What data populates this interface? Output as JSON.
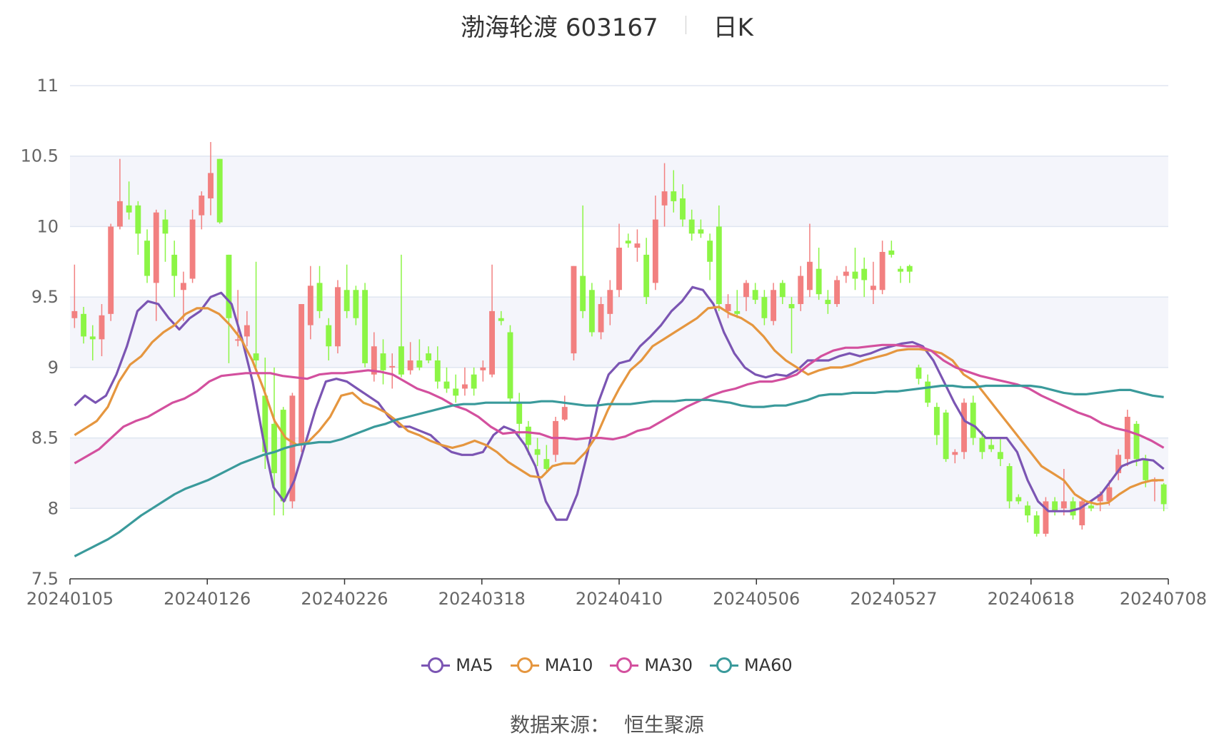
{
  "title": {
    "name": "渤海轮渡 603167",
    "period": "日K"
  },
  "source": {
    "label": "数据来源：",
    "value": "恒生聚源"
  },
  "chart_data": {
    "type": "candlestick",
    "ylim": [
      7.5,
      11
    ],
    "y_ticks": [
      "7.5",
      "8",
      "8.5",
      "9",
      "9.5",
      "10",
      "10.5",
      "11"
    ],
    "x_ticks": [
      "20240105",
      "20240126",
      "20240226",
      "20240318",
      "20240410",
      "20240506",
      "20240527",
      "20240618",
      "20240708"
    ],
    "colors": {
      "up": "#f28080",
      "down": "#8cf545",
      "band": "#f4f5fb",
      "grid": "#e0e6f1",
      "axis": "#333333"
    },
    "candles": [
      [
        9.35,
        9.4,
        9.73,
        9.28
      ],
      [
        9.38,
        9.22,
        9.43,
        9.17
      ],
      [
        9.22,
        9.2,
        9.3,
        9.05
      ],
      [
        9.2,
        9.37,
        9.45,
        9.08
      ],
      [
        9.38,
        10.0,
        10.02,
        9.33
      ],
      [
        10.0,
        10.18,
        10.48,
        9.98
      ],
      [
        10.15,
        10.1,
        10.32,
        10.05
      ],
      [
        10.15,
        9.95,
        10.18,
        9.8
      ],
      [
        9.9,
        9.65,
        9.98,
        9.6
      ],
      [
        9.6,
        10.1,
        10.12,
        9.33
      ],
      [
        10.05,
        9.95,
        10.12,
        9.75
      ],
      [
        9.8,
        9.65,
        9.9,
        9.5
      ],
      [
        9.55,
        9.6,
        9.68,
        9.33
      ],
      [
        9.63,
        10.05,
        10.12,
        9.6
      ],
      [
        10.08,
        10.22,
        10.25,
        9.98
      ],
      [
        10.2,
        10.38,
        10.6,
        10.08
      ],
      [
        10.48,
        10.03,
        10.48,
        10.02
      ],
      [
        9.8,
        9.35,
        9.8,
        9.03
      ],
      [
        9.2,
        9.2,
        9.55,
        9.15
      ],
      [
        9.22,
        9.3,
        9.4,
        9.15
      ],
      [
        9.1,
        9.05,
        9.75,
        8.98
      ],
      [
        8.8,
        8.4,
        9.07,
        8.28
      ],
      [
        8.6,
        8.25,
        9.0,
        7.95
      ],
      [
        8.7,
        8.05,
        8.72,
        7.95
      ],
      [
        8.05,
        8.8,
        8.82,
        8.0
      ],
      [
        8.45,
        9.45,
        9.45,
        8.4
      ],
      [
        9.3,
        9.58,
        9.72,
        9.2
      ],
      [
        9.6,
        9.4,
        9.72,
        9.35
      ],
      [
        9.3,
        9.15,
        9.35,
        9.05
      ],
      [
        9.15,
        9.57,
        9.62,
        9.1
      ],
      [
        9.55,
        9.4,
        9.73,
        9.35
      ],
      [
        9.55,
        9.35,
        9.58,
        9.3
      ],
      [
        9.55,
        9.03,
        9.6,
        9.0
      ],
      [
        8.95,
        9.15,
        9.25,
        8.9
      ],
      [
        9.1,
        8.98,
        9.2,
        8.88
      ],
      [
        9.0,
        9.01,
        9.1,
        8.85
      ],
      [
        9.15,
        8.95,
        9.8,
        8.93
      ],
      [
        8.98,
        9.05,
        9.18,
        8.95
      ],
      [
        9.05,
        9.0,
        9.2,
        8.98
      ],
      [
        9.1,
        9.05,
        9.15,
        9.03
      ],
      [
        9.05,
        8.9,
        9.15,
        8.85
      ],
      [
        8.9,
        8.85,
        9.0,
        8.82
      ],
      [
        8.85,
        8.8,
        8.95,
        8.75
      ],
      [
        8.85,
        8.88,
        9.0,
        8.8
      ],
      [
        8.95,
        8.85,
        9.0,
        8.8
      ],
      [
        8.98,
        9.0,
        9.05,
        8.9
      ],
      [
        8.95,
        9.4,
        9.73,
        8.93
      ],
      [
        9.35,
        9.33,
        9.4,
        9.3
      ],
      [
        9.25,
        8.78,
        9.3,
        8.75
      ],
      [
        8.75,
        8.6,
        8.82,
        8.5
      ],
      [
        8.58,
        8.45,
        8.62,
        8.38
      ],
      [
        8.42,
        8.38,
        8.5,
        8.3
      ],
      [
        8.35,
        8.28,
        8.45,
        8.25
      ],
      [
        8.38,
        8.62,
        8.65,
        8.33
      ],
      [
        8.63,
        8.72,
        8.8,
        8.62
      ],
      [
        9.1,
        9.72,
        9.72,
        9.05
      ],
      [
        9.65,
        9.4,
        10.15,
        9.35
      ],
      [
        9.55,
        9.25,
        9.6,
        9.22
      ],
      [
        9.25,
        9.45,
        9.5,
        9.2
      ],
      [
        9.38,
        9.55,
        9.62,
        9.3
      ],
      [
        9.55,
        9.85,
        10.02,
        9.5
      ],
      [
        9.9,
        9.88,
        9.95,
        9.85
      ],
      [
        9.85,
        9.88,
        9.98,
        9.75
      ],
      [
        9.8,
        9.5,
        9.92,
        9.45
      ],
      [
        9.6,
        10.05,
        10.22,
        9.55
      ],
      [
        10.15,
        10.25,
        10.45,
        10.0
      ],
      [
        10.25,
        10.18,
        10.4,
        10.1
      ],
      [
        10.2,
        10.05,
        10.3,
        10.0
      ],
      [
        10.05,
        9.95,
        10.12,
        9.9
      ],
      [
        9.98,
        9.95,
        10.05,
        9.92
      ],
      [
        9.9,
        9.75,
        9.95,
        9.62
      ],
      [
        10.0,
        9.45,
        10.15,
        9.4
      ],
      [
        9.4,
        9.45,
        9.52,
        9.35
      ],
      [
        9.4,
        9.38,
        9.55,
        9.35
      ],
      [
        9.5,
        9.6,
        9.62,
        9.4
      ],
      [
        9.55,
        9.48,
        9.6,
        9.45
      ],
      [
        9.5,
        9.35,
        9.55,
        9.3
      ],
      [
        9.33,
        9.55,
        9.6,
        9.3
      ],
      [
        9.6,
        9.5,
        9.62,
        9.45
      ],
      [
        9.45,
        9.42,
        9.5,
        9.1
      ],
      [
        9.45,
        9.65,
        9.72,
        9.4
      ],
      [
        9.55,
        9.75,
        10.02,
        9.5
      ],
      [
        9.7,
        9.52,
        9.85,
        9.48
      ],
      [
        9.48,
        9.45,
        9.55,
        9.38
      ],
      [
        9.45,
        9.62,
        9.65,
        9.43
      ],
      [
        9.65,
        9.68,
        9.72,
        9.6
      ],
      [
        9.68,
        9.63,
        9.85,
        9.55
      ],
      [
        9.7,
        9.62,
        9.78,
        9.5
      ],
      [
        9.55,
        9.58,
        9.75,
        9.45
      ],
      [
        9.55,
        9.82,
        9.9,
        9.52
      ],
      [
        9.83,
        9.8,
        9.9,
        9.78
      ],
      [
        9.7,
        9.68,
        9.72,
        9.6
      ],
      [
        9.72,
        9.68,
        9.73,
        9.6
      ],
      [
        9.0,
        8.92,
        9.02,
        8.88
      ],
      [
        8.9,
        8.75,
        8.95,
        8.72
      ],
      [
        8.72,
        8.52,
        8.75,
        8.45
      ],
      [
        8.68,
        8.35,
        8.7,
        8.33
      ],
      [
        8.38,
        8.4,
        8.42,
        8.32
      ],
      [
        8.4,
        8.75,
        8.78,
        8.35
      ],
      [
        8.75,
        8.5,
        8.8,
        8.45
      ],
      [
        8.5,
        8.4,
        8.55,
        8.35
      ],
      [
        8.45,
        8.42,
        8.5,
        8.4
      ],
      [
        8.4,
        8.35,
        8.5,
        8.3
      ],
      [
        8.3,
        8.05,
        8.32,
        8.0
      ],
      [
        8.08,
        8.05,
        8.1,
        8.03
      ],
      [
        8.02,
        7.95,
        8.05,
        7.9
      ],
      [
        7.95,
        7.82,
        7.98,
        7.8
      ],
      [
        7.82,
        8.05,
        8.08,
        7.8
      ],
      [
        8.05,
        7.98,
        8.08,
        7.95
      ],
      [
        8.0,
        8.05,
        8.28,
        7.95
      ],
      [
        8.05,
        7.95,
        8.08,
        7.92
      ],
      [
        7.88,
        8.05,
        8.07,
        7.85
      ],
      [
        8.02,
        8.0,
        8.06,
        7.98
      ],
      [
        8.05,
        8.1,
        8.12,
        7.98
      ],
      [
        8.05,
        8.15,
        8.2,
        8.02
      ],
      [
        8.25,
        8.38,
        8.42,
        8.2
      ],
      [
        8.35,
        8.65,
        8.7,
        8.3
      ],
      [
        8.6,
        8.35,
        8.62,
        8.3
      ],
      [
        8.35,
        8.2,
        8.38,
        8.15
      ],
      [
        8.2,
        8.2,
        8.22,
        8.05
      ],
      [
        8.17,
        8.03,
        8.18,
        7.98
      ]
    ],
    "series": [
      {
        "name": "MA5",
        "color": "#7b55b3",
        "values": [
          8.73,
          8.8,
          8.75,
          8.8,
          8.95,
          9.15,
          9.4,
          9.47,
          9.45,
          9.35,
          9.27,
          9.35,
          9.4,
          9.5,
          9.53,
          9.45,
          9.2,
          8.9,
          8.5,
          8.15,
          8.05,
          8.2,
          8.45,
          8.7,
          8.9,
          8.92,
          8.9,
          8.85,
          8.8,
          8.75,
          8.65,
          8.58,
          8.58,
          8.55,
          8.52,
          8.45,
          8.4,
          8.38,
          8.38,
          8.4,
          8.52,
          8.58,
          8.55,
          8.45,
          8.3,
          8.05,
          7.92,
          7.92,
          8.1,
          8.4,
          8.75,
          8.95,
          9.03,
          9.05,
          9.15,
          9.22,
          9.3,
          9.4,
          9.47,
          9.57,
          9.55,
          9.45,
          9.25,
          9.1,
          9.0,
          8.95,
          8.93,
          8.95,
          8.94,
          8.98,
          9.05,
          9.05,
          9.05,
          9.08,
          9.1,
          9.08,
          9.1,
          9.13,
          9.15,
          9.17,
          9.18,
          9.15,
          9.05,
          8.9,
          8.75,
          8.62,
          8.58,
          8.5,
          8.5,
          8.5,
          8.4,
          8.2,
          8.05,
          7.98,
          7.98,
          7.98,
          8.0,
          8.05,
          8.1,
          8.2,
          8.3,
          8.33,
          8.35,
          8.34,
          8.28
        ]
      },
      {
        "name": "MA10",
        "color": "#e5963f",
        "values": [
          8.52,
          8.57,
          8.62,
          8.72,
          8.9,
          9.02,
          9.08,
          9.18,
          9.25,
          9.3,
          9.38,
          9.42,
          9.42,
          9.38,
          9.3,
          9.2,
          9.05,
          8.85,
          8.62,
          8.5,
          8.45,
          8.47,
          8.55,
          8.65,
          8.8,
          8.82,
          8.75,
          8.72,
          8.68,
          8.62,
          8.55,
          8.52,
          8.48,
          8.45,
          8.43,
          8.45,
          8.48,
          8.45,
          8.4,
          8.33,
          8.28,
          8.23,
          8.22,
          8.3,
          8.32,
          8.32,
          8.4,
          8.52,
          8.7,
          8.85,
          8.98,
          9.05,
          9.15,
          9.2,
          9.25,
          9.3,
          9.35,
          9.42,
          9.43,
          9.38,
          9.35,
          9.3,
          9.22,
          9.12,
          9.05,
          9.0,
          8.95,
          8.98,
          9.0,
          9.0,
          9.02,
          9.05,
          9.07,
          9.09,
          9.12,
          9.13,
          9.13,
          9.12,
          9.1,
          9.05,
          8.95,
          8.9,
          8.8,
          8.7,
          8.6,
          8.5,
          8.4,
          8.3,
          8.25,
          8.2,
          8.1,
          8.05,
          8.03,
          8.04,
          8.1,
          8.15,
          8.18,
          8.2,
          8.2
        ]
      },
      {
        "name": "MA30",
        "color": "#d3509e",
        "values": [
          8.32,
          8.37,
          8.42,
          8.5,
          8.58,
          8.62,
          8.65,
          8.7,
          8.75,
          8.78,
          8.83,
          8.9,
          8.94,
          8.95,
          8.96,
          8.96,
          8.96,
          8.94,
          8.93,
          8.92,
          8.95,
          8.96,
          8.96,
          8.97,
          8.98,
          8.97,
          8.95,
          8.9,
          8.85,
          8.82,
          8.78,
          8.73,
          8.7,
          8.65,
          8.58,
          8.53,
          8.54,
          8.54,
          8.53,
          8.5,
          8.5,
          8.49,
          8.5,
          8.5,
          8.49,
          8.51,
          8.55,
          8.57,
          8.62,
          8.67,
          8.72,
          8.76,
          8.8,
          8.83,
          8.85,
          8.88,
          8.9,
          8.9,
          8.92,
          8.95,
          9.02,
          9.08,
          9.12,
          9.14,
          9.14,
          9.15,
          9.16,
          9.16,
          9.15,
          9.15,
          9.12,
          9.05,
          9.0,
          8.97,
          8.94,
          8.92,
          8.9,
          8.88,
          8.85,
          8.8,
          8.76,
          8.72,
          8.68,
          8.65,
          8.6,
          8.57,
          8.55,
          8.52,
          8.48,
          8.43
        ]
      },
      {
        "name": "MA60",
        "color": "#3a9a9b",
        "values": [
          7.66,
          7.7,
          7.74,
          7.78,
          7.83,
          7.89,
          7.95,
          8.0,
          8.05,
          8.1,
          8.14,
          8.17,
          8.2,
          8.24,
          8.28,
          8.32,
          8.35,
          8.38,
          8.4,
          8.43,
          8.45,
          8.46,
          8.47,
          8.47,
          8.49,
          8.52,
          8.55,
          8.58,
          8.6,
          8.63,
          8.65,
          8.67,
          8.69,
          8.71,
          8.73,
          8.74,
          8.74,
          8.75,
          8.75,
          8.75,
          8.75,
          8.75,
          8.76,
          8.76,
          8.75,
          8.74,
          8.73,
          8.73,
          8.74,
          8.74,
          8.74,
          8.75,
          8.76,
          8.76,
          8.76,
          8.77,
          8.77,
          8.77,
          8.76,
          8.75,
          8.73,
          8.72,
          8.72,
          8.73,
          8.73,
          8.75,
          8.77,
          8.8,
          8.81,
          8.81,
          8.82,
          8.82,
          8.82,
          8.83,
          8.83,
          8.84,
          8.85,
          8.86,
          8.87,
          8.87,
          8.86,
          8.86,
          8.87,
          8.87,
          8.87,
          8.87,
          8.87,
          8.86,
          8.84,
          8.82,
          8.81,
          8.81,
          8.82,
          8.83,
          8.84,
          8.84,
          8.82,
          8.8,
          8.79
        ]
      }
    ]
  }
}
